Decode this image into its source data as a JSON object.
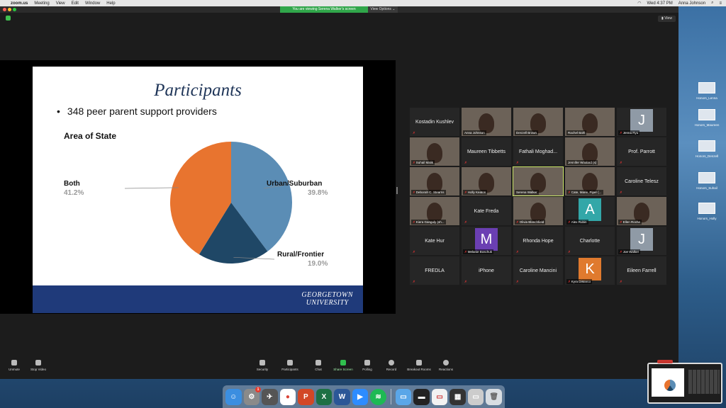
{
  "menubar": {
    "app_name": "zoom.us",
    "menus": [
      "Meeting",
      "View",
      "Edit",
      "Window",
      "Help"
    ],
    "clock": "Wed 4:37 PM",
    "user": "Anna Johnson"
  },
  "zoom": {
    "viewing_banner": "You are viewing Serena Walker's screen",
    "view_options": "View Options ⌄",
    "view_button": "▮ View"
  },
  "slide": {
    "title": "Participants",
    "bullet": "348 peer parent support providers",
    "footer_logo_line1": "GEORGETOWN",
    "footer_logo_line2": "UNIVERSITY"
  },
  "chart_data": {
    "type": "pie",
    "title": "Area of State",
    "slices": [
      {
        "label": "Urban/Suburban",
        "value": 39.8,
        "display": "39.8%",
        "color": "#5b8db5"
      },
      {
        "label": "Rural/Frontier",
        "value": 19.0,
        "display": "19.0%",
        "color": "#1f4766"
      },
      {
        "label": "Both",
        "value": 41.2,
        "display": "41.2%",
        "color": "#e8742f"
      }
    ]
  },
  "gallery": [
    {
      "name": "Kostadin Kushlev",
      "kind": "name"
    },
    {
      "name": "Anna Johnson",
      "kind": "video"
    },
    {
      "name": "Denzell Brown",
      "kind": "video"
    },
    {
      "name": "Rachel Bahl",
      "kind": "video"
    },
    {
      "name": "Jenna Ryu",
      "kind": "avatar",
      "letter": "J",
      "color": "#8f9aa6"
    },
    {
      "name": "Suhail Malik",
      "kind": "video",
      "muted": true
    },
    {
      "name": "Maureen Tibbetts",
      "kind": "name"
    },
    {
      "name": "Fathali Moghad...",
      "kind": "name"
    },
    {
      "name": "Jennifer Woolard (s)",
      "kind": "video"
    },
    {
      "name": "Prof. Parrott",
      "kind": "name"
    },
    {
      "name": "Deborah C. Stearns",
      "kind": "video",
      "muted": true
    },
    {
      "name": "Holly Keaton",
      "kind": "video",
      "muted": true
    },
    {
      "name": "Serena Walker",
      "kind": "video",
      "active": true
    },
    {
      "name": "Cate, Marie, Piper (...",
      "kind": "video",
      "muted": true
    },
    {
      "name": "Caroline Telesz",
      "kind": "name"
    },
    {
      "name": "Kiera Ganguly (sh...",
      "kind": "video",
      "muted": true
    },
    {
      "name": "Kate Freda",
      "kind": "name"
    },
    {
      "name": "Olivia Blanchfield",
      "kind": "video",
      "muted": true
    },
    {
      "name": "Alex Rubin",
      "kind": "avatar",
      "letter": "A",
      "color": "#33a7a8"
    },
    {
      "name": "Ellen Roche",
      "kind": "video",
      "muted": true
    },
    {
      "name": "Kate Hur",
      "kind": "name"
    },
    {
      "name": "Melanie Boschuk",
      "kind": "avatar",
      "letter": "M",
      "color": "#6b3fb3"
    },
    {
      "name": "Rhonda Hope",
      "kind": "name"
    },
    {
      "name": "Charlotte",
      "kind": "name"
    },
    {
      "name": "Joe Walker",
      "kind": "avatar",
      "letter": "J",
      "color": "#8f9aa6"
    },
    {
      "name": "FREDLA",
      "kind": "name"
    },
    {
      "name": "iPhone",
      "kind": "name"
    },
    {
      "name": "Caroline Mancini",
      "kind": "name"
    },
    {
      "name": "Kyra DiMarco",
      "kind": "avatar",
      "letter": "K",
      "color": "#e07a2e"
    },
    {
      "name": "Eileen Farrell",
      "kind": "name"
    }
  ],
  "toolbar": {
    "unmute": "Unmute",
    "stop_video": "Stop Video",
    "security": "Security",
    "participants": "Participants",
    "participants_count": "30",
    "chat": "Chat",
    "share_screen": "Share Screen",
    "polling": "Polling",
    "record": "Record",
    "breakout_rooms": "Breakout Rooms",
    "reactions": "Reactions"
  },
  "desktop_icons": [
    "Honors_Lenna",
    "Honors_Maureen",
    "Honors_Denzell",
    "Honors_Suhail",
    "Honors_Holly"
  ]
}
